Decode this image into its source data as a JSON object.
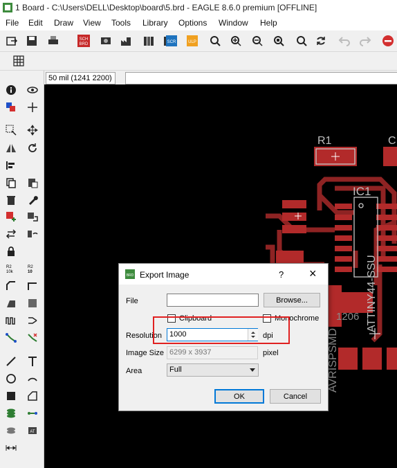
{
  "window": {
    "title": "1 Board - C:\\Users\\DELL\\Desktop\\board\\5.brd - EAGLE 8.6.0 premium [OFFLINE]"
  },
  "menu": [
    "File",
    "Edit",
    "Draw",
    "View",
    "Tools",
    "Library",
    "Options",
    "Window",
    "Help"
  ],
  "toolbar": {
    "sch_brd_label": "SCH\nBRD",
    "scr_label": "SCR",
    "ulp_label": "ULP"
  },
  "coordinates": "50 mil (1241 2200)",
  "board": {
    "labels": [
      "R1",
      "IC1",
      "ATTINY44-SSU",
      "1206",
      "AVRISPSMD",
      "C"
    ]
  },
  "dialog": {
    "title": "Export Image",
    "help_label": "?",
    "close_label": "×",
    "file_label": "File",
    "file_value": "",
    "browse_label": "Browse...",
    "clipboard_label": "Clipboard",
    "monochrome_label": "Monochrome",
    "resolution_label": "Resolution",
    "resolution_value": "1000",
    "resolution_unit": "dpi",
    "image_size_label": "Image Size",
    "image_size_value": "6299 x 3937",
    "image_size_unit": "pixel",
    "area_label": "Area",
    "area_value": "Full",
    "ok_label": "OK",
    "cancel_label": "Cancel"
  },
  "colors": {
    "trace": "#8e2323",
    "pad": "#b22a2a",
    "canvas": "#000000",
    "highlight": "#e02020",
    "ok_border": "#0078d7"
  }
}
